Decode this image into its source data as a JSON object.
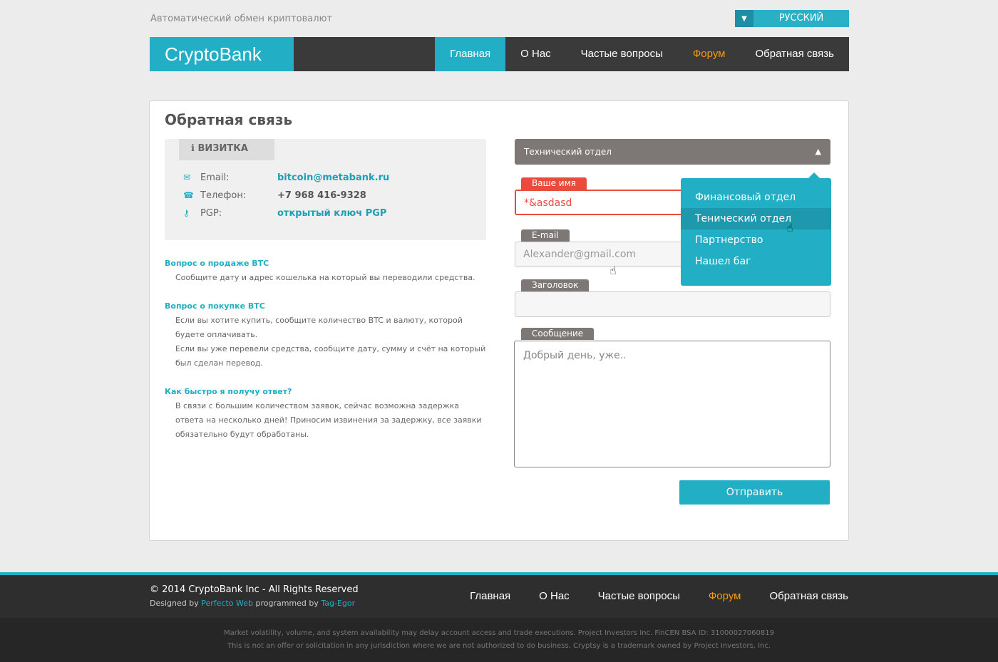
{
  "top": {
    "tagline": "Автоматический обмен криптовалют",
    "language": "РУССКИЙ"
  },
  "header": {
    "logo": "CryptoBank",
    "nav": [
      "Главная",
      "О Нас",
      "Частые вопросы",
      "Форум",
      "Обратная связь"
    ]
  },
  "page": {
    "title": "Обратная связь"
  },
  "card": {
    "tab": "ВИЗИТКА",
    "email_label": "Email:",
    "email_value": "bitcoin@metabank.ru",
    "phone_label": "Телефон:",
    "phone_value": "+7 968 416-9328",
    "pgp_label": "PGP:",
    "pgp_value": "открытый ключ PGP"
  },
  "faq": [
    {
      "q": "Вопрос о продаже BTC",
      "a": [
        "Сообщите дату и адрес кошелька на который вы переводили средства."
      ]
    },
    {
      "q": "Вопрос о покупке BTC",
      "a": [
        "Если вы хотите купить, сообщите количество BTC и валюту, которой будете оплачивать.",
        "Если вы уже перевели средства, сообщите дату, сумму и счёт на который был сделан перевод."
      ]
    },
    {
      "q": "Как быстро я получу ответ?",
      "a": [
        "В связи с большим количеством заявок, сейчас возможна задержка ответа на несколько дней! Приносим извинения за задержку, все заявки обязательно будут обработаны."
      ]
    }
  ],
  "form": {
    "department": "Технический отдел",
    "name_label": "Ваше имя",
    "name_value": "*&asdasd",
    "email_label": "E-mail",
    "email_placeholder": "Alexander@gmail.com",
    "subject_label": "Заголовок",
    "message_label": "Сообщение",
    "message_placeholder": "Добрый день, уже..",
    "submit": "Отправить"
  },
  "dropdown": [
    "Финансовый отдел",
    "Тенический отдел",
    "Партнерство",
    "Нашел баг"
  ],
  "footer": {
    "copyright": "© 2014 CryptoBank Inc - All Rights Reserved",
    "designed_by": "Designed by",
    "designer": "Perfecto Web",
    "programmed_by": "programmed by",
    "programmer": "Tag-Egor",
    "nav": [
      "Главная",
      "О Нас",
      "Частые вопросы",
      "Форум",
      "Обратная связь"
    ]
  },
  "legal": [
    "Market volatility, volume, and system availability may delay account access and trade executions. Project Investors Inc. FinCEN BSA ID: 31000027060819",
    "This is not an offer or solicitation in any jurisdiction where we are not authorized to do business. Cryptsy is a trademark owned by Project Investors, Inc."
  ],
  "colors": {
    "accent": "#22aec4",
    "error": "#e94c3c",
    "forum": "#f39c12"
  }
}
